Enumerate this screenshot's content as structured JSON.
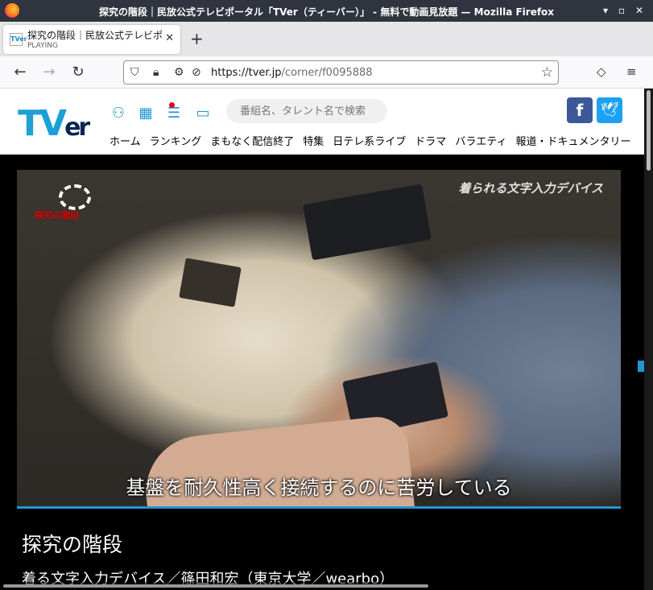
{
  "window": {
    "title": "探究の階段｜民放公式テレビポータル「TVer（ティーバー）」 - 無料で動画見放題 — Mozilla Firefox",
    "minimize": "▾",
    "maximize": "▫",
    "close": "✕"
  },
  "tab": {
    "favicon": "TVer",
    "title": "探究の階段｜民放公式テレビポ",
    "status": "PLAYING",
    "close": "✕",
    "new_tab": "+"
  },
  "navbar": {
    "back": "←",
    "forward": "→",
    "reload": "↻",
    "url_host": "https://tver.jp",
    "url_path": "/corner/f0095888",
    "bookmark": "☆",
    "pocket": "◇",
    "menu": "≡"
  },
  "site": {
    "logo_t": "T",
    "logo_v": "V",
    "logo_er": "er",
    "search_placeholder": "番組名、タレント名で検索",
    "facebook": "f",
    "twitter": "🕊",
    "nav": [
      "ホーム",
      "ランキング",
      "まもなく配信終了",
      "特集",
      "日テレ系ライブ",
      "ドラマ",
      "バラエティ",
      "報道・ドキュメンタリー"
    ]
  },
  "player": {
    "program_logo": "探究の階段",
    "top_caption": "着られる文字入力デバイス",
    "subtitle": "基盤を耐久性高く接続するのに苦労している",
    "progress": 1.0
  },
  "episode": {
    "title": "探究の階段",
    "subtitle": "着る文字入力デバイス／篠田和宏（東京大学／wearbo）"
  },
  "colors": {
    "accent": "#2196d3",
    "facebook": "#3b5998",
    "twitter": "#1da1f2",
    "notification": "#e60012"
  }
}
